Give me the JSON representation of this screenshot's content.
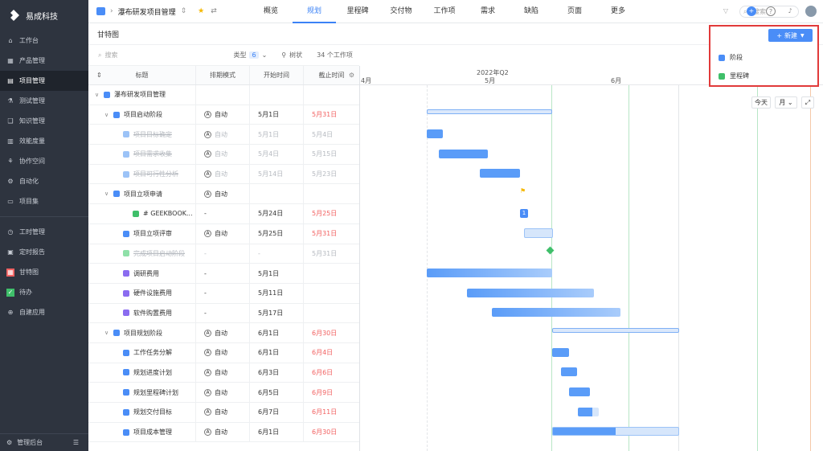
{
  "brand": "易成科技",
  "sidebar": {
    "items": [
      {
        "label": "工作台",
        "icon": "home-icon"
      },
      {
        "label": "产品管理",
        "icon": "grid-icon"
      },
      {
        "label": "项目管理",
        "icon": "project-icon",
        "active": true
      },
      {
        "label": "测试管理",
        "icon": "test-icon"
      },
      {
        "label": "知识管理",
        "icon": "book-icon"
      },
      {
        "label": "效能度量",
        "icon": "chart-icon"
      },
      {
        "label": "协作空间",
        "icon": "team-icon"
      },
      {
        "label": "自动化",
        "icon": "robot-icon"
      },
      {
        "label": "项目集",
        "icon": "folder-icon"
      },
      {
        "label": "工时管理",
        "icon": "clock-icon"
      },
      {
        "label": "定时报告",
        "icon": "report-icon"
      },
      {
        "label": "甘特图",
        "icon": "gantt-icon"
      },
      {
        "label": "待办",
        "icon": "todo-icon"
      },
      {
        "label": "自建应用",
        "icon": "apps-icon"
      }
    ],
    "bottom": "管理后台"
  },
  "header": {
    "project": "瀑布研发项目管理",
    "tabs": [
      "概览",
      "规划",
      "里程碑",
      "交付物",
      "工作项",
      "需求",
      "缺陷",
      "页面",
      "更多"
    ],
    "active_tab": "规划",
    "search_placeholder": "搜索"
  },
  "subbar": {
    "title": "甘特图"
  },
  "toolbar": {
    "search_placeholder": "搜索",
    "type_label": "类型",
    "type_count": "6",
    "tree_label": "树状",
    "count": "34 个工作项"
  },
  "columns": {
    "title": "标题",
    "mode": "排期模式",
    "start": "开始时间",
    "end": "截止时间"
  },
  "rows": [
    {
      "indent": 0,
      "caret": "∨",
      "icon": "folder",
      "color": "#4a8df7",
      "title": "瀑布研发项目管理",
      "mode": "",
      "start": "",
      "end": "",
      "end_red": false,
      "strike": false
    },
    {
      "indent": 1,
      "caret": "∨",
      "icon": "stage",
      "color": "#4a8df7",
      "title": "项目启动阶段",
      "mode": "自动",
      "start": "5月1日",
      "end": "5月31日",
      "end_red": true,
      "strike": false
    },
    {
      "indent": 2,
      "caret": "",
      "icon": "stage",
      "color": "#9cc3f7",
      "title": "项目目标确定",
      "mode": "自动",
      "start": "5月1日",
      "end": "5月4日",
      "end_red": false,
      "strike": true
    },
    {
      "indent": 2,
      "caret": "",
      "icon": "stage",
      "color": "#9cc3f7",
      "title": "项目需求收集",
      "mode": "自动",
      "start": "5月4日",
      "end": "5月15日",
      "end_red": false,
      "strike": true
    },
    {
      "indent": 2,
      "caret": "",
      "icon": "stage",
      "color": "#9cc3f7",
      "title": "项目可行性分析",
      "mode": "自动",
      "start": "5月14日",
      "end": "5月23日",
      "end_red": false,
      "strike": true
    },
    {
      "indent": 1,
      "caret": "∨",
      "icon": "stage",
      "color": "#4a8df7",
      "title": "项目立项申请",
      "mode": "自动",
      "start": "",
      "end": "",
      "end_red": false,
      "strike": false,
      "sub": true
    },
    {
      "indent": 3,
      "caret": "",
      "icon": "check",
      "color": "#3fbf6a",
      "title": "# GEEKBOOK...",
      "mode": "-",
      "start": "5月24日",
      "end": "5月25日",
      "end_red": true,
      "strike": false
    },
    {
      "indent": 2,
      "caret": "",
      "icon": "stage",
      "color": "#4a8df7",
      "title": "项目立项评审",
      "mode": "自动",
      "start": "5月25日",
      "end": "5月31日",
      "end_red": true,
      "strike": false
    },
    {
      "indent": 2,
      "caret": "",
      "icon": "milestone",
      "color": "#8fe0a8",
      "title": "完成项目启动阶段",
      "mode": "-",
      "start": "-",
      "end": "5月31日",
      "end_red": false,
      "strike": true
    },
    {
      "indent": 2,
      "caret": "",
      "icon": "cost",
      "color": "#8b6cf0",
      "title": "调研费用",
      "mode": "-",
      "start": "5月1日",
      "end": "",
      "end_red": false,
      "strike": false
    },
    {
      "indent": 2,
      "caret": "",
      "icon": "cost",
      "color": "#8b6cf0",
      "title": "硬件设施费用",
      "mode": "-",
      "start": "5月11日",
      "end": "",
      "end_red": false,
      "strike": false
    },
    {
      "indent": 2,
      "caret": "",
      "icon": "cost",
      "color": "#8b6cf0",
      "title": "软件购置费用",
      "mode": "-",
      "start": "5月17日",
      "end": "",
      "end_red": false,
      "strike": false
    },
    {
      "indent": 1,
      "caret": "∨",
      "icon": "stage",
      "color": "#4a8df7",
      "title": "项目规划阶段",
      "mode": "自动",
      "start": "6月1日",
      "end": "6月30日",
      "end_red": true,
      "strike": false
    },
    {
      "indent": 2,
      "caret": "",
      "icon": "stage",
      "color": "#4a8df7",
      "title": "工作任务分解",
      "mode": "自动",
      "start": "6月1日",
      "end": "6月4日",
      "end_red": true,
      "strike": false
    },
    {
      "indent": 2,
      "caret": "",
      "icon": "stage",
      "color": "#4a8df7",
      "title": "规划进度计划",
      "mode": "自动",
      "start": "6月3日",
      "end": "6月6日",
      "end_red": true,
      "strike": false
    },
    {
      "indent": 2,
      "caret": "",
      "icon": "stage",
      "color": "#4a8df7",
      "title": "规划里程碑计划",
      "mode": "自动",
      "start": "6月5日",
      "end": "6月9日",
      "end_red": true,
      "strike": false
    },
    {
      "indent": 2,
      "caret": "",
      "icon": "stage",
      "color": "#4a8df7",
      "title": "规划交付目标",
      "mode": "自动",
      "start": "6月7日",
      "end": "6月11日",
      "end_red": true,
      "strike": false
    },
    {
      "indent": 2,
      "caret": "",
      "icon": "stage",
      "color": "#4a8df7",
      "title": "项目成本管理",
      "mode": "自动",
      "start": "6月1日",
      "end": "6月30日",
      "end_red": true,
      "strike": false
    }
  ],
  "gantt": {
    "quarter": "2022年Q2",
    "months": [
      "4月",
      "5月",
      "6月"
    ],
    "today_label": "今天",
    "scale_label": "月",
    "badge": "1"
  },
  "new_menu": {
    "button": "新建",
    "items": [
      "阶段",
      "里程碑"
    ]
  }
}
